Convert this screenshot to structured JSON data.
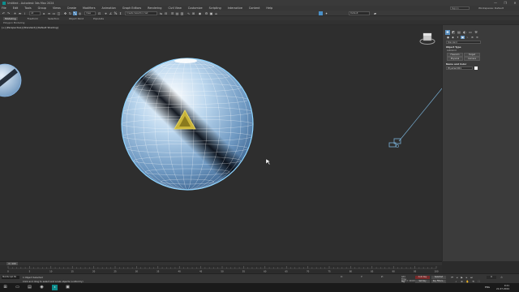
{
  "window": {
    "title": "Untitled - Autodesk 3ds Max 2024",
    "controls": [
      "—",
      "❐",
      "✕"
    ]
  },
  "menubar": {
    "items": [
      "File",
      "Edit",
      "Tools",
      "Group",
      "Views",
      "Create",
      "Modifiers",
      "Animation",
      "Graph Editors",
      "Rendering",
      "Civil View",
      "Customize",
      "Scripting",
      "Interactive",
      "Content",
      "Help"
    ],
    "signin": "Sign In",
    "workspaces": "Workspaces: Default"
  },
  "toolbar": {
    "filter_dropdown": "All",
    "selection_set": "Create Selection Set",
    "view_dropdown": "View",
    "reference_dropdown": "Default"
  },
  "ribbon": {
    "tabs": [
      "Modeling",
      "Freeform",
      "Selection",
      "Object Paint",
      "Populate"
    ],
    "active_tab": "Modeling",
    "sub_label": "Polygon Modeling"
  },
  "viewport": {
    "label": "[+] [Perspective] [Standard] [Default Shading]"
  },
  "command_panel": {
    "tabs": [
      "✚",
      "◩",
      "▤",
      "◐",
      "▭",
      "⚒"
    ],
    "sub_icons": [
      "●",
      "◆",
      "✦",
      "▣",
      "⌁",
      "⊕",
      "≋"
    ],
    "category": "Standard",
    "object_type_title": "Object Type",
    "autogrid": "AutoGrid",
    "buttons": [
      "Freecam",
      "Target",
      "Physical",
      "Camera"
    ],
    "name_color_title": "Name and Color",
    "name_value": "PhysCam001"
  },
  "timeline": {
    "slider": "0 / 100"
  },
  "trackbar": {
    "ticks": [
      "0",
      "5",
      "10",
      "15",
      "20",
      "25",
      "30",
      "35",
      "40",
      "45",
      "50",
      "55",
      "60",
      "65",
      "70",
      "75",
      "80",
      "85",
      "90",
      "95",
      "100"
    ]
  },
  "statusbar": {
    "maxscript": "MAXScript Mi",
    "line1": "1 Object Selected",
    "line2": "Click and drag to select and scale objects (uniformly)",
    "x_label": "X:",
    "y_label": "Y:",
    "z_label": "Z:",
    "grid": "Grid = 10.0mm",
    "add_time_tag": "Add Time Tag",
    "auto_key": "Auto Key",
    "selected": "Selected",
    "set_key": "Set Key",
    "key_filters": "Key Filters...",
    "frame": "0"
  },
  "taskbar": {
    "lang": "ENG",
    "time": "9:21",
    "date": "21.07.2024"
  }
}
